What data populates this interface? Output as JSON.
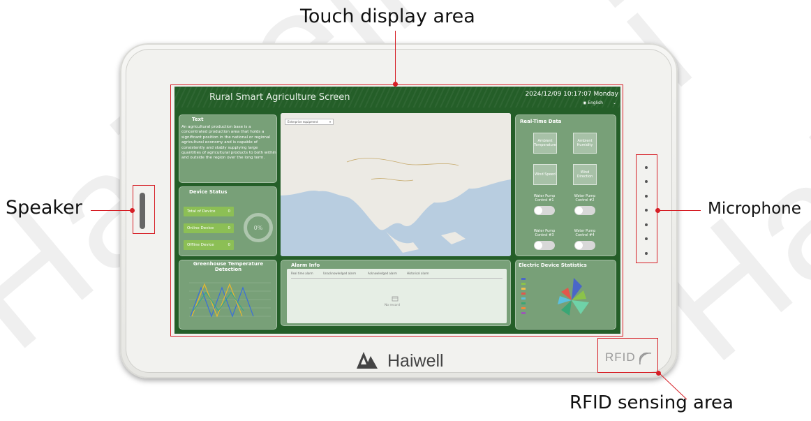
{
  "callouts": {
    "touch_display": "Touch display area",
    "speaker": "Speaker",
    "microphone": "Microphone",
    "rfid_area": "RFID sensing area"
  },
  "device": {
    "brand": "Haiwell",
    "rfid_label": "RFID"
  },
  "screen": {
    "title": "Rural Smart Agriculture Screen",
    "datetime": "2024/12/09 10:17:07 Monday",
    "language": "English",
    "text_panel": {
      "title": "Text",
      "body": "An agricultural production base is a concentrated production area that holds a significant position in the national or regional agricultural economy and is capable of consistently and stably supplying large quantities of agricultural products to both within and outside the region over the long term."
    },
    "device_status": {
      "title": "Device Status",
      "rows": [
        {
          "label": "Total of Device",
          "value": "0"
        },
        {
          "label": "Online Device",
          "value": "0"
        },
        {
          "label": "Offline Device",
          "value": "0"
        }
      ],
      "percent": "0%"
    },
    "map": {
      "select_value": "Enterprise equipment"
    },
    "real_time": {
      "title": "Real-Time Data",
      "tiles": [
        "Ambient Temperature",
        "Ambient Humidity",
        "Wind Speed",
        "Wind Direction"
      ],
      "pumps": [
        "Water Pump Control #1",
        "Water Pump Control #2",
        "Water Pump Control #3",
        "Water Pump Control #4"
      ]
    },
    "greenhouse": {
      "title": "Greenhouse Temperature Detection"
    },
    "alarm": {
      "title": "Alarm Info",
      "tabs": [
        "Real time alarm",
        "Unacknowledged alarm",
        "Acknowledged alarm",
        "Historical alarm"
      ],
      "empty": "No record"
    },
    "electric": {
      "title": "Electric Device Statistics"
    }
  },
  "colors": {
    "callout_red": "#d61f26",
    "screen_green": "#245e28",
    "badge_green": "#8cbf55"
  }
}
